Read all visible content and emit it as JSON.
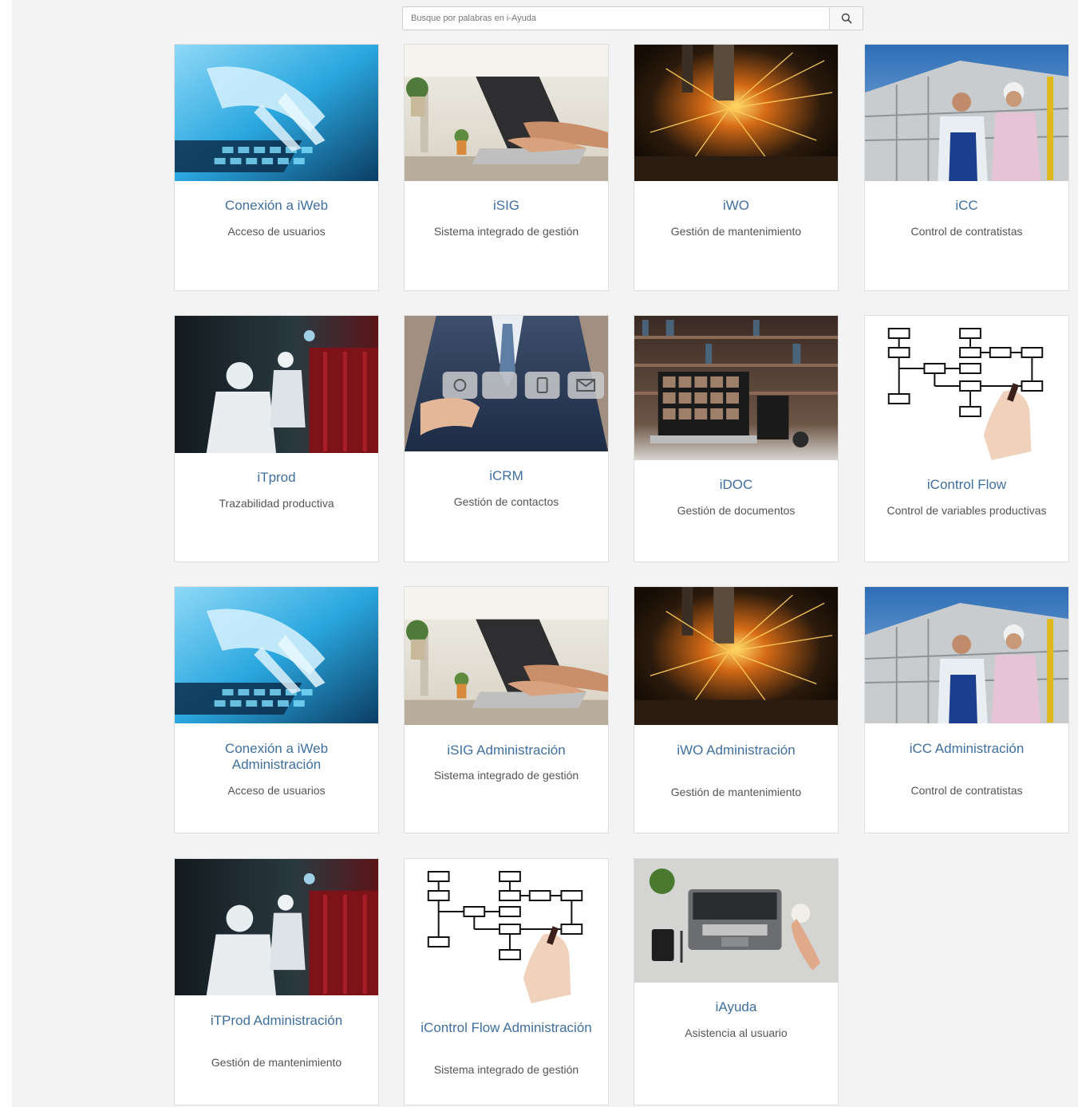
{
  "search": {
    "placeholder": "Busque por palabras en i-Ayuda",
    "icon": "search-icon"
  },
  "cards": [
    {
      "title": "Conexión a iWeb",
      "subtitle": "Acceso de usuarios"
    },
    {
      "title": "iSIG",
      "subtitle": "Sistema integrado de gestión"
    },
    {
      "title": "iWO",
      "subtitle": "Gestión de mantenimiento"
    },
    {
      "title": "iCC",
      "subtitle": "Control de contratistas"
    },
    {
      "title": "iTprod",
      "subtitle": "Trazabilidad productiva"
    },
    {
      "title": "iCRM",
      "subtitle": "Gestión de contactos"
    },
    {
      "title": "iDOC",
      "subtitle": "Gestión de documentos"
    },
    {
      "title": "iControl Flow",
      "subtitle": "Control de variables productivas"
    },
    {
      "title": "Conexión a iWeb Administración",
      "subtitle": "Acceso de usuarios"
    },
    {
      "title": "iSIG Administración",
      "subtitle": "Sistema integrado de gestión"
    },
    {
      "title": "iWO Administración",
      "subtitle": "Gestión de mantenimiento"
    },
    {
      "title": "iCC Administración",
      "subtitle": "Control de contratistas"
    },
    {
      "title": "iTProd Administración",
      "subtitle": "Gestión de mantenimiento"
    },
    {
      "title": "iControl Flow Administración",
      "subtitle": "Sistema integrado de gestión"
    },
    {
      "title": "iAyuda",
      "subtitle": "Asistencia al usuario"
    }
  ]
}
